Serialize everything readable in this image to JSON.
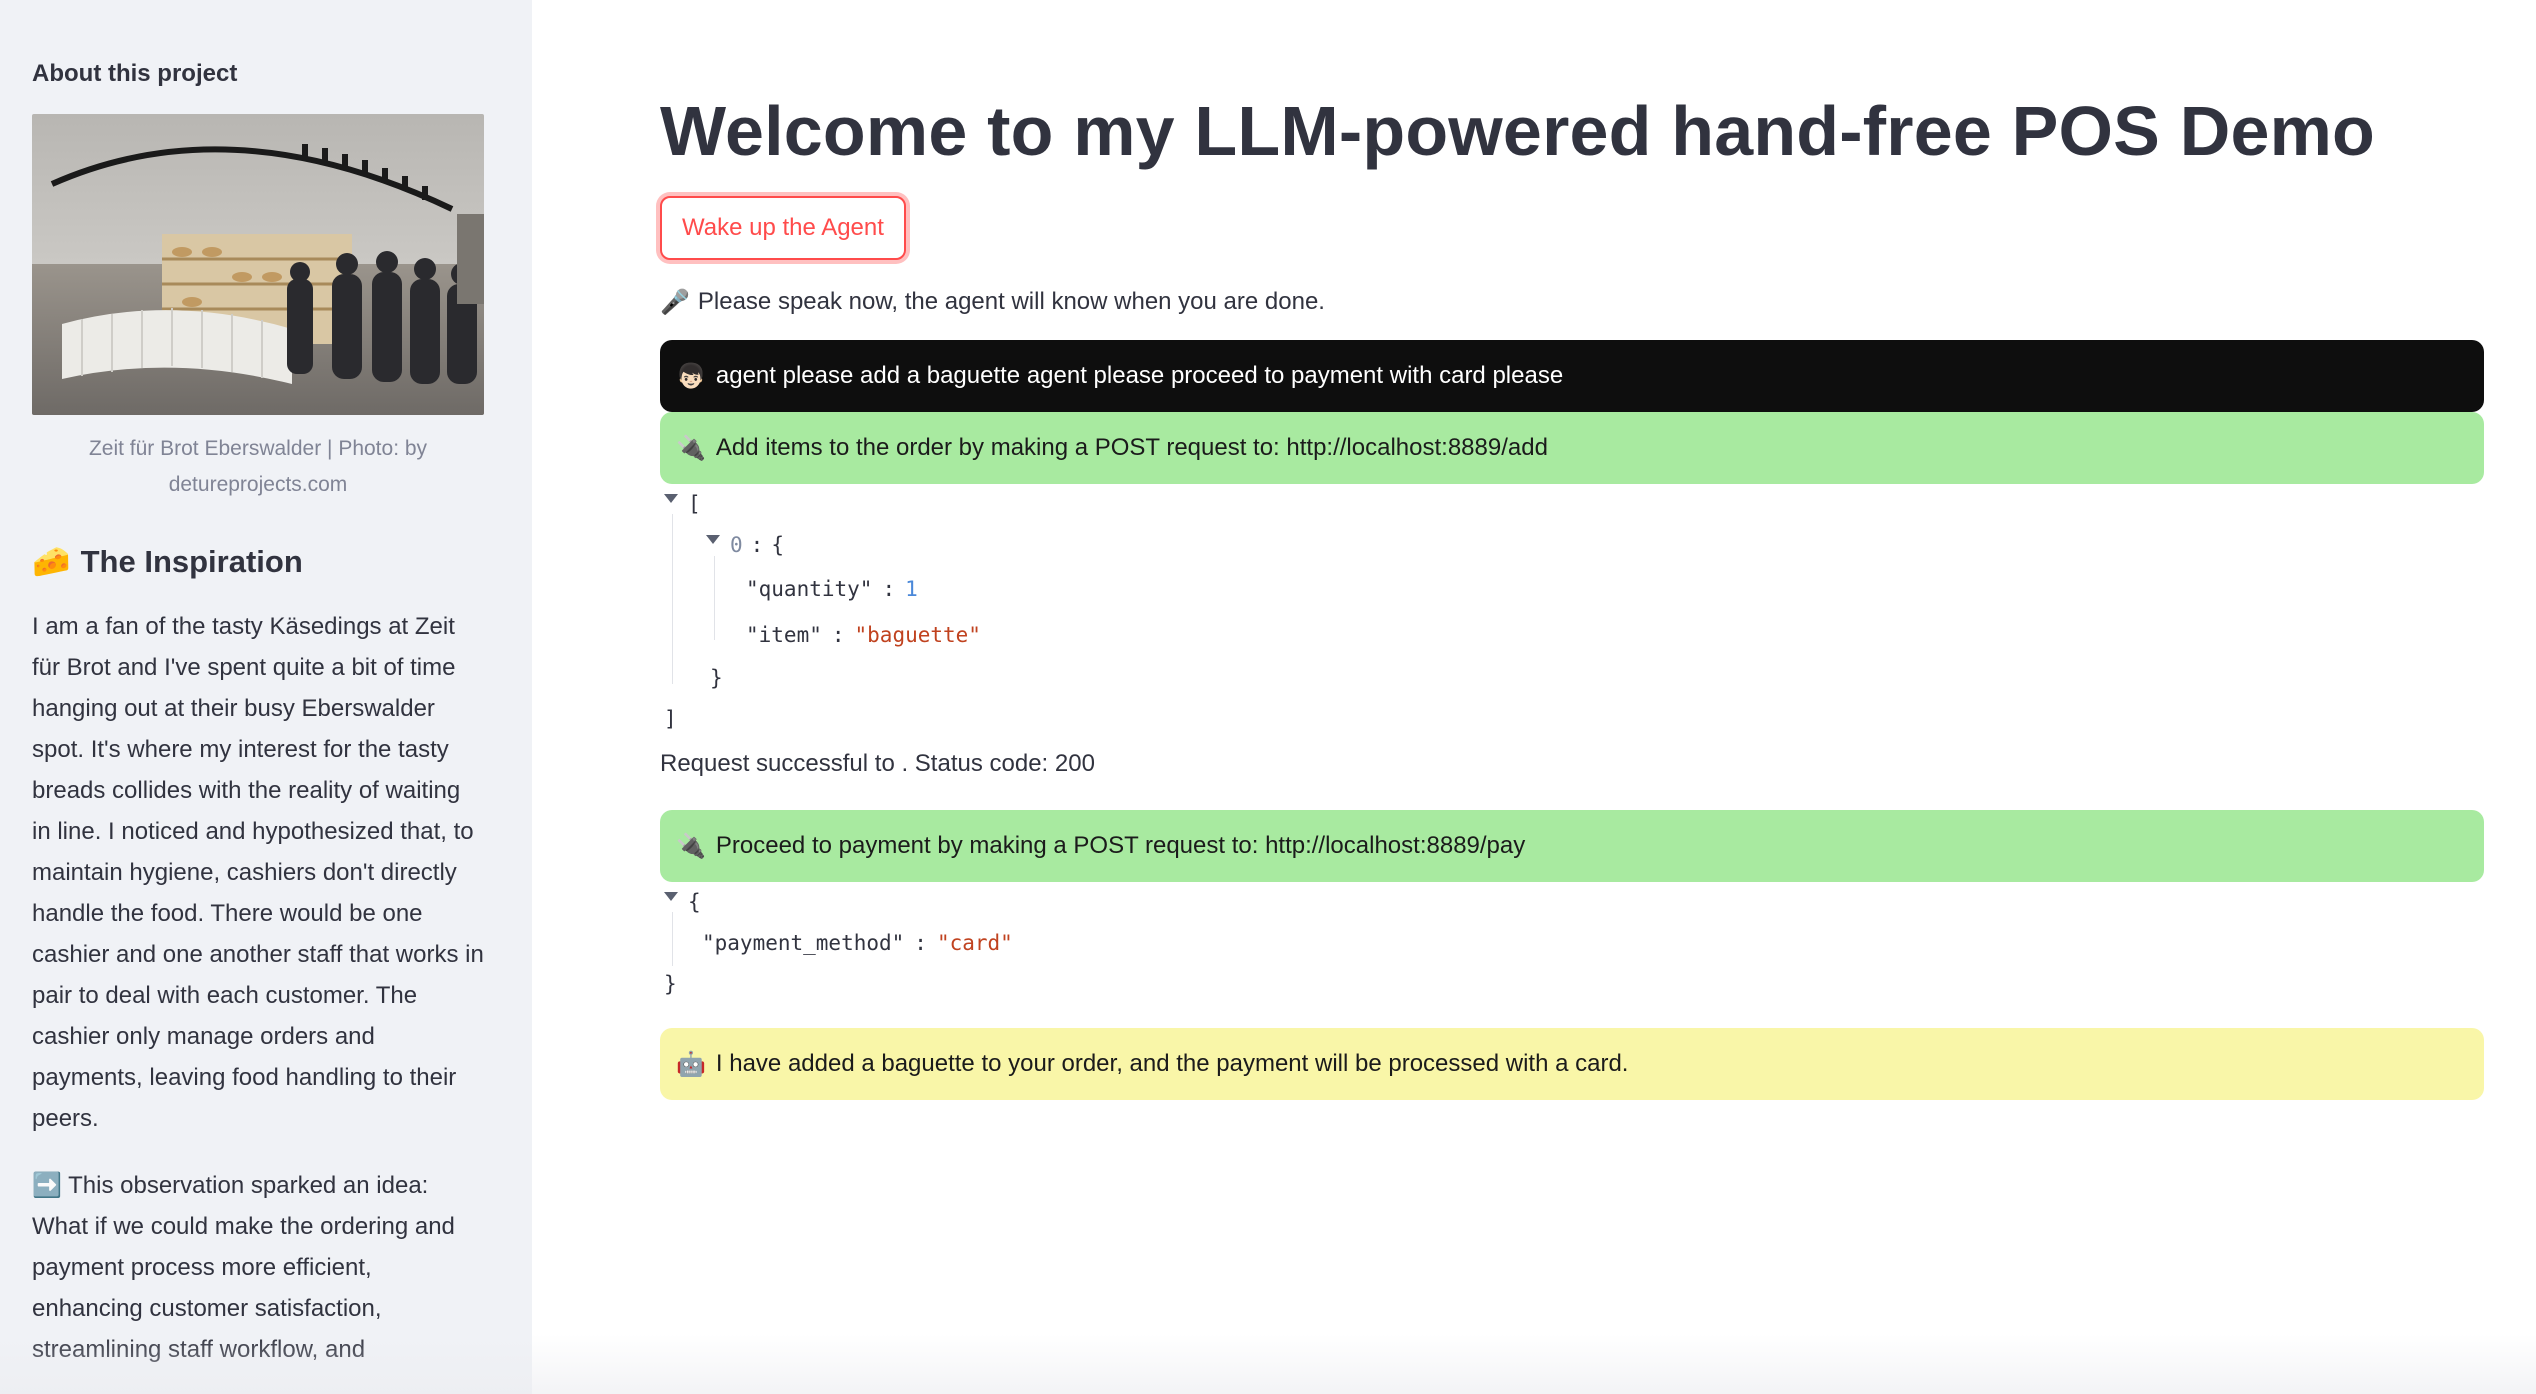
{
  "sidebar": {
    "heading": "About this project",
    "photo_caption_line1": "Zeit für Brot Eberswalder | Photo: by",
    "photo_caption_line2": "detureprojects.com",
    "section_icon": "🧀",
    "section_title": "The Inspiration",
    "paragraph1": "I am a fan of the tasty Käsedings at Zeit für Brot and I've spent quite a bit of time hanging out at their busy Eberswalder spot. It's where my interest for the tasty breads collides with the reality of waiting in line. I noticed and hypothesized that, to maintain hygiene, cashiers don't directly handle the food. There would be one cashier and one another staff that works in pair to deal with each customer. The cashier only manage orders and payments, leaving food handling to their peers.",
    "paragraph2_icon": "➡️",
    "paragraph2": "This observation sparked an idea: What if we could make the ordering and payment process more efficient, enhancing customer satisfaction, streamlining staff workflow, and"
  },
  "main": {
    "title": "Welcome to my LLM-powered hand-free POS Demo",
    "wake_button": "Wake up the Agent",
    "speak_icon": "🎤",
    "speak_text": "Please speak now, the agent will know when you are done.",
    "user_icon": "👦🏻",
    "user_message": "agent please add a baguette agent please proceed to payment with card please",
    "tool1_icon": "🔌",
    "tool1_message": "Add items to the order by making a POST request to: http://localhost:8889/add",
    "json1": {
      "open": "[",
      "index": "0",
      "colon": ":",
      "brace_open": "{",
      "quantity_key": "\"quantity\"",
      "quantity_value": "1",
      "item_key": "\"item\"",
      "item_value": "\"baguette\"",
      "brace_close": "}",
      "close": "]"
    },
    "status_text": "Request successful to . Status code: 200",
    "tool2_icon": "🔌",
    "tool2_message": "Proceed to payment by making a POST request to: http://localhost:8889/pay",
    "json2": {
      "open": "{",
      "method_key": "\"payment_method\"",
      "method_value": "\"card\"",
      "close": "}"
    },
    "agent_icon": "🤖",
    "agent_message": "I have added a baguette to your order, and the payment will be processed with a card."
  },
  "colors": {
    "sidebar_bg": "#f0f2f6",
    "accent": "#ff4b4b",
    "user_bubble": "#0e0e0e",
    "tool_bubble": "#a8eaa0",
    "agent_bubble": "#f9f6a8"
  }
}
